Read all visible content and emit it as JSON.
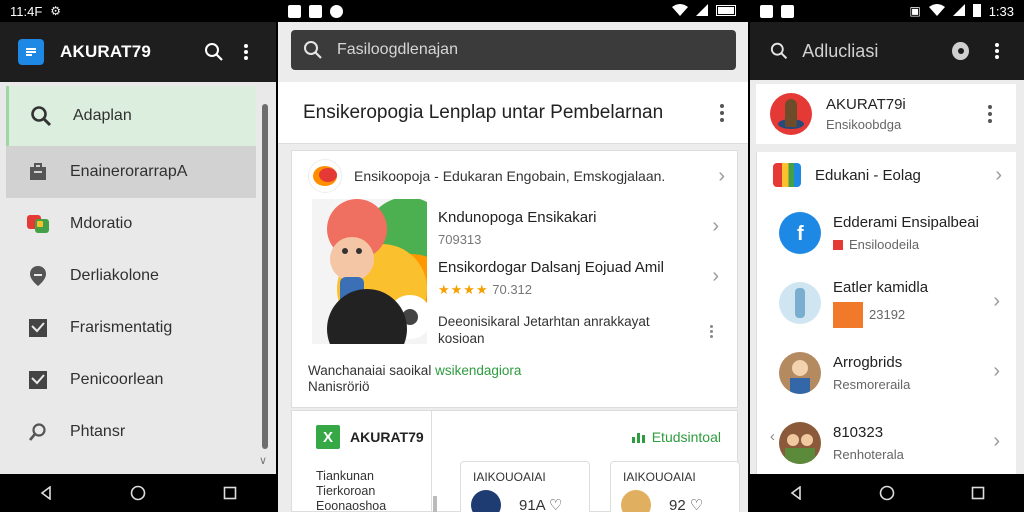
{
  "left": {
    "status": {
      "time": "11:4F"
    },
    "appbar": {
      "title": "AKURAT79"
    },
    "drawer": [
      {
        "label": "Adaplan",
        "icon": "search-icon"
      },
      {
        "label": "EnainerorarrapА",
        "icon": "briefcase-icon"
      },
      {
        "label": "Mdoratio",
        "icon": "photos-icon"
      },
      {
        "label": "Derliakolone",
        "icon": "location-pin-icon"
      },
      {
        "label": "Frarismentatig",
        "icon": "check-box-icon"
      },
      {
        "label": "Penicoorlean",
        "icon": "check-box-icon"
      },
      {
        "label": "Phtansr",
        "icon": "magnifier-icon"
      }
    ]
  },
  "middle": {
    "search": {
      "placeholder": "Fasiloogdlenajan"
    },
    "header": {
      "title": "Ensikeropogia Lenplap untar Pembelarnan"
    },
    "card1": {
      "head": "Ensikoopoja - Edukaran Engobain, Emskogjalaan.",
      "items": [
        {
          "title": "Kndunopoga Ensikakari",
          "sub": "709313"
        },
        {
          "title": "Ensikordogar Dalsanj Eojuad Amil",
          "stars": "★★★★",
          "rating": "70.312"
        },
        {
          "line1": "Deeonisikaral Jetarhtan anrakkayat",
          "line2": "kosioan"
        }
      ],
      "footer_text": "Wanchanaiai saoikal",
      "footer_link": "wsikendagiora",
      "footer_line2": "Nanisröriö"
    },
    "card2": {
      "brand": "AKURAT79",
      "sub1": "Tiankunan",
      "sub2": "Tierkoroan",
      "sub3": "Eoonaoshoa",
      "green_label": "Etudsintoal",
      "mini1": {
        "label": "IAIKOUOAIAI",
        "value": "91A ♡"
      },
      "mini2": {
        "label": "IAIKOUOAIAI",
        "value": "92 ♡"
      }
    }
  },
  "right": {
    "status": {
      "time": "1:33"
    },
    "search": {
      "placeholder": "Adlucliasi"
    },
    "profile": {
      "name": "AKURAT79i",
      "sub": "Ensikoobdga"
    },
    "list_head": "Edukani - Eolag",
    "rows": [
      {
        "title": "Edderami Ensipalbeai",
        "sub": "Ensiloodeila"
      },
      {
        "title": "Eatler kamidla",
        "sub": "23192"
      },
      {
        "title": "Arrogbrids",
        "sub": "Resmoreraila"
      },
      {
        "title": "810323",
        "sub": "Renhoterala"
      }
    ]
  },
  "colors": {
    "accent_green": "#2e9c3f",
    "app_blue": "#1e88e5",
    "drawer_active": "#dcefde"
  }
}
